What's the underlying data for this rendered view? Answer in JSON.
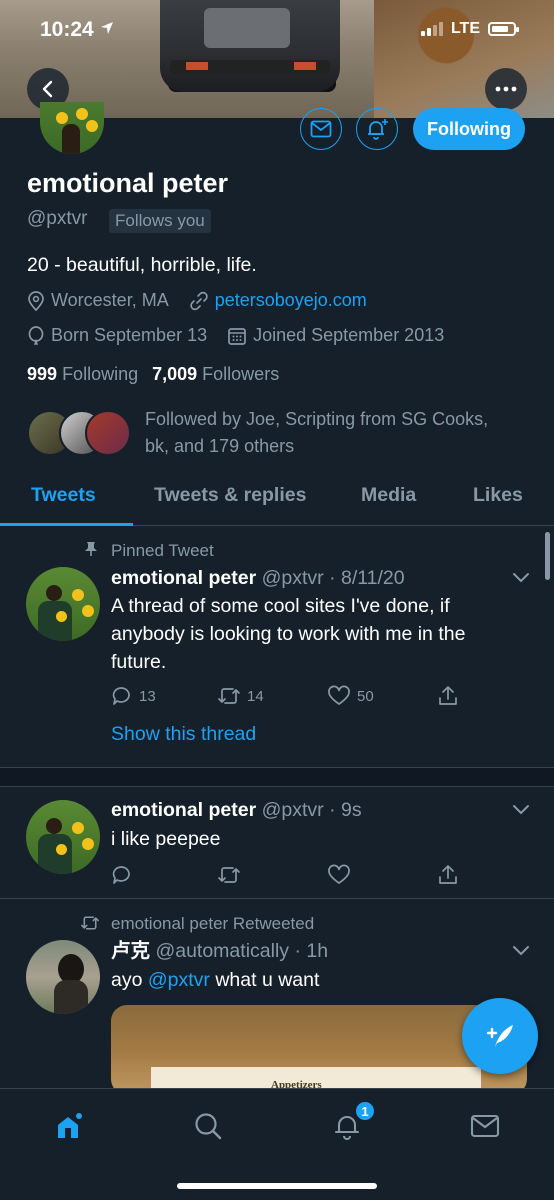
{
  "status_bar": {
    "time": "10:24",
    "network": "LTE"
  },
  "profile": {
    "name": "emotional peter",
    "handle": "@pxtvr",
    "follows_you": "Follows you",
    "following_label": "Following",
    "bio": "20 - beautiful, horrible, life.",
    "location": "Worcester, MA",
    "website": "petersoboyejo.com",
    "birthday": "Born September 13",
    "joined": "Joined September 2013",
    "following_count": "999",
    "following_text": "Following",
    "followers_count": "7,009",
    "followers_text": "Followers",
    "followed_by_line1": "Followed by Joe, Scripting from SG Cooks,",
    "followed_by_line2": "bk, and 179 others"
  },
  "tabs": [
    {
      "label": "Tweets"
    },
    {
      "label": "Tweets & replies"
    },
    {
      "label": "Media"
    },
    {
      "label": "Likes"
    }
  ],
  "tweets": [
    {
      "context": "Pinned Tweet",
      "name": "emotional peter",
      "handle_time": "@pxtvr · 8/11/20",
      "lines": [
        "A thread of some cool sites I've done, if",
        "anybody is looking to work with me in the",
        "future."
      ],
      "replies": "13",
      "retweets": "14",
      "likes": "50",
      "show_thread": "Show this thread"
    },
    {
      "name": "emotional peter",
      "handle_time": "@pxtvr · 9s",
      "text": "i like peepee"
    },
    {
      "context": "emotional peter Retweeted",
      "name": "卢克",
      "handle_time": "@automatically · 1h",
      "text_pre": "ayo ",
      "mention": "@pxtvr",
      "text_post": " what u want",
      "media_caption": "Appetizers"
    }
  ],
  "notifications_badge": "1",
  "colors": {
    "background": "#15202b",
    "accent": "#1da1f2",
    "secondary_text": "#8899a6",
    "divider": "#38444d"
  },
  "icons": [
    "back-arrow-icon",
    "more-icon",
    "mail-icon",
    "bell-plus-icon",
    "location-icon",
    "link-icon",
    "balloon-icon",
    "calendar-icon",
    "pin-icon",
    "reply-icon",
    "retweet-icon",
    "like-icon",
    "share-icon",
    "chevron-down-icon",
    "compose-icon",
    "home-icon",
    "search-icon",
    "notifications-icon",
    "messages-icon"
  ]
}
